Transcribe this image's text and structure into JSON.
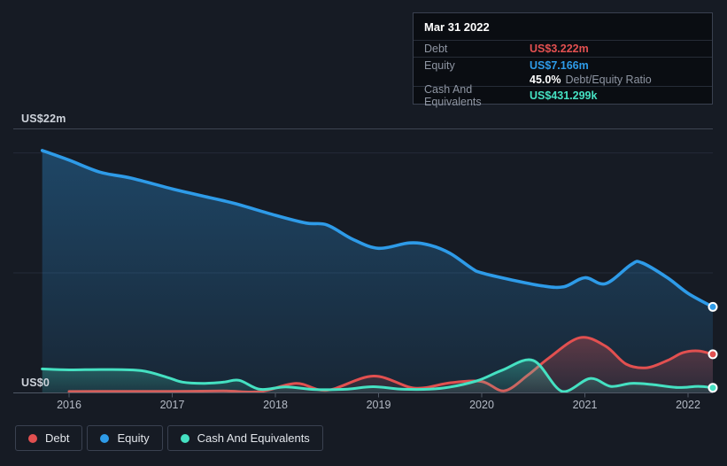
{
  "colors": {
    "debt": "#e25050",
    "equity": "#2e9be8",
    "cash": "#45e1c2",
    "background": "#161b24",
    "tooltip_background": "#0a0d12"
  },
  "tooltip": {
    "title": "Mar 31 2022",
    "debt_label": "Debt",
    "debt_value": "US$3.222m",
    "equity_label": "Equity",
    "equity_value": "US$7.166m",
    "ratio_value": "45.0%",
    "ratio_label": "Debt/Equity Ratio",
    "cash_label": "Cash And Equivalents",
    "cash_value": "US$431.299k"
  },
  "axis": {
    "y_max_label": "US$22m",
    "y_zero_label": "US$0",
    "x_ticks": [
      "2016",
      "2017",
      "2018",
      "2019",
      "2020",
      "2021",
      "2022"
    ]
  },
  "legend": {
    "items": [
      {
        "label": "Debt"
      },
      {
        "label": "Equity"
      },
      {
        "label": "Cash And Equivalents"
      }
    ]
  },
  "chart_data": {
    "type": "area",
    "y_unit": "US$ millions",
    "ylim": [
      0,
      22
    ],
    "gridlines": [
      10,
      20
    ],
    "x_range": [
      2015.74,
      2022.24
    ],
    "last_point_date": "Mar 31 2022",
    "series": [
      {
        "name": "Debt",
        "color": "#e25050",
        "z": 1,
        "points": [
          [
            2016.0,
            0.12
          ],
          [
            2016.5,
            0.13
          ],
          [
            2017.0,
            0.13
          ],
          [
            2017.5,
            0.16
          ],
          [
            2017.85,
            0.1
          ],
          [
            2018.2,
            0.8
          ],
          [
            2018.5,
            0.22
          ],
          [
            2018.95,
            1.4
          ],
          [
            2019.35,
            0.4
          ],
          [
            2019.7,
            0.85
          ],
          [
            2020.0,
            0.95
          ],
          [
            2020.22,
            0.18
          ],
          [
            2020.45,
            1.5
          ],
          [
            2020.65,
            2.9
          ],
          [
            2020.95,
            4.6
          ],
          [
            2021.2,
            3.9
          ],
          [
            2021.4,
            2.4
          ],
          [
            2021.6,
            2.1
          ],
          [
            2021.8,
            2.7
          ],
          [
            2021.95,
            3.35
          ],
          [
            2022.1,
            3.5
          ],
          [
            2022.24,
            3.222
          ]
        ]
      },
      {
        "name": "Equity",
        "color": "#2e9be8",
        "z": 0,
        "points": [
          [
            2015.74,
            20.2
          ],
          [
            2016.0,
            19.4
          ],
          [
            2016.3,
            18.4
          ],
          [
            2016.6,
            17.9
          ],
          [
            2017.0,
            17.0
          ],
          [
            2017.3,
            16.4
          ],
          [
            2017.6,
            15.8
          ],
          [
            2018.0,
            14.8
          ],
          [
            2018.3,
            14.15
          ],
          [
            2018.5,
            14.0
          ],
          [
            2018.75,
            12.8
          ],
          [
            2019.0,
            12.05
          ],
          [
            2019.3,
            12.5
          ],
          [
            2019.5,
            12.3
          ],
          [
            2019.7,
            11.6
          ],
          [
            2019.9,
            10.4
          ],
          [
            2020.0,
            10.0
          ],
          [
            2020.3,
            9.4
          ],
          [
            2020.6,
            8.9
          ],
          [
            2020.8,
            8.85
          ],
          [
            2021.0,
            9.6
          ],
          [
            2021.2,
            9.1
          ],
          [
            2021.45,
            10.7
          ],
          [
            2021.55,
            10.85
          ],
          [
            2021.8,
            9.6
          ],
          [
            2022.0,
            8.3
          ],
          [
            2022.24,
            7.166
          ]
        ]
      },
      {
        "name": "Cash And Equivalents",
        "color": "#45e1c2",
        "z": 2,
        "points": [
          [
            2015.74,
            2.0
          ],
          [
            2016.0,
            1.92
          ],
          [
            2016.35,
            1.95
          ],
          [
            2016.7,
            1.85
          ],
          [
            2016.95,
            1.3
          ],
          [
            2017.1,
            0.9
          ],
          [
            2017.3,
            0.8
          ],
          [
            2017.5,
            0.9
          ],
          [
            2017.65,
            1.05
          ],
          [
            2017.85,
            0.3
          ],
          [
            2018.1,
            0.5
          ],
          [
            2018.4,
            0.27
          ],
          [
            2018.7,
            0.32
          ],
          [
            2018.95,
            0.52
          ],
          [
            2019.25,
            0.3
          ],
          [
            2019.6,
            0.38
          ],
          [
            2019.95,
            1.0
          ],
          [
            2020.2,
            1.9
          ],
          [
            2020.5,
            2.7
          ],
          [
            2020.78,
            0.12
          ],
          [
            2021.05,
            1.2
          ],
          [
            2021.25,
            0.55
          ],
          [
            2021.45,
            0.8
          ],
          [
            2021.65,
            0.7
          ],
          [
            2021.9,
            0.45
          ],
          [
            2022.1,
            0.55
          ],
          [
            2022.24,
            0.431
          ]
        ]
      }
    ]
  }
}
